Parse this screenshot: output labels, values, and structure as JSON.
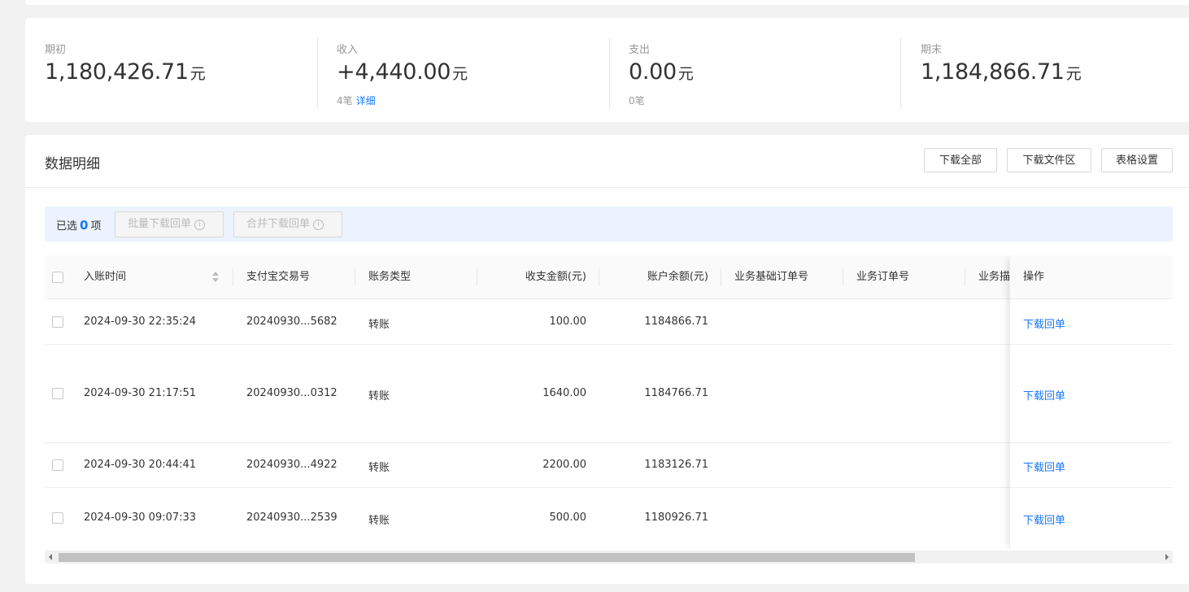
{
  "summary": {
    "opening": {
      "label": "期初",
      "value": "1,180,426.71",
      "unit": "元"
    },
    "income": {
      "label": "收入",
      "value": "+4,440.00",
      "unit": "元",
      "count": "4笔",
      "detail_link": "详细"
    },
    "expense": {
      "label": "支出",
      "value": "0.00",
      "unit": "元",
      "count": "0笔"
    },
    "closing": {
      "label": "期末",
      "value": "1,184,866.71",
      "unit": "元"
    }
  },
  "detail": {
    "title": "数据明细",
    "buttons": {
      "download_all": "下载全部",
      "download_area": "下载文件区",
      "table_settings": "表格设置"
    },
    "selection": {
      "prefix": "已选",
      "count": "0",
      "suffix": "项",
      "batch_download": "批量下载回单",
      "merge_download": "合并下载回单"
    },
    "columns": [
      "入账时间",
      "支付宝交易号",
      "账务类型",
      "收支金额(元)",
      "账户余额(元)",
      "业务基础订单号",
      "业务订单号",
      "业务描述",
      "操作"
    ],
    "rows": [
      {
        "time": "2024-09-30 22:35:24",
        "trade_no": "20240930...5682",
        "type": "转账",
        "amount": "100.00",
        "balance": "1184866.71",
        "action": "下载回单"
      },
      {
        "time": "2024-09-30 21:17:51",
        "trade_no": "20240930...0312",
        "type": "转账",
        "amount": "1640.00",
        "balance": "1184766.71",
        "action": "下载回单"
      },
      {
        "time": "2024-09-30 20:44:41",
        "trade_no": "20240930...4922",
        "type": "转账",
        "amount": "2200.00",
        "balance": "1183126.71",
        "action": "下载回单"
      },
      {
        "time": "2024-09-30 09:07:33",
        "trade_no": "20240930...2539",
        "type": "转账",
        "amount": "500.00",
        "balance": "1180926.71",
        "action": "下载回单"
      }
    ]
  },
  "colors": {
    "link": "#1677ff",
    "selection_bg": "#ecf3fe",
    "page_bg": "#f2f2f2"
  }
}
